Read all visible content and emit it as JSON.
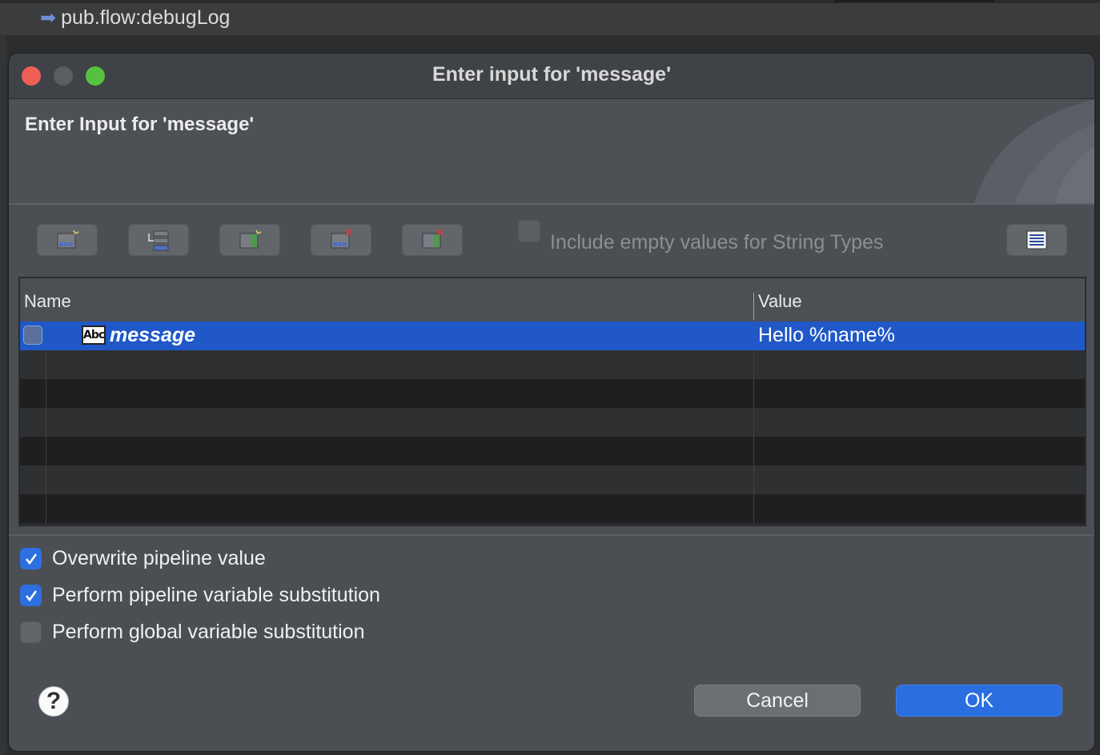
{
  "background": {
    "editor_item": "pub.flow:debugLog"
  },
  "dialog": {
    "window_title": "Enter input for 'message'",
    "banner_title": "Enter Input for 'message'",
    "include_empty_label": "Include empty values for String Types",
    "include_empty_checked": false,
    "toolbar_icons": [
      "insert-row-icon",
      "add-group-icon",
      "insert-column-icon",
      "delete-row-icon",
      "delete-column-icon"
    ],
    "table": {
      "columns": [
        "Name",
        "Value"
      ],
      "rows": [
        {
          "name": "message",
          "value": "Hello %name%",
          "type_icon": "Abc",
          "selected": true
        }
      ]
    },
    "options": [
      {
        "label": "Overwrite pipeline value",
        "checked": true
      },
      {
        "label": "Perform pipeline variable substitution",
        "checked": true
      },
      {
        "label": "Perform global variable substitution",
        "checked": false
      }
    ],
    "buttons": {
      "cancel": "Cancel",
      "ok": "OK"
    }
  }
}
